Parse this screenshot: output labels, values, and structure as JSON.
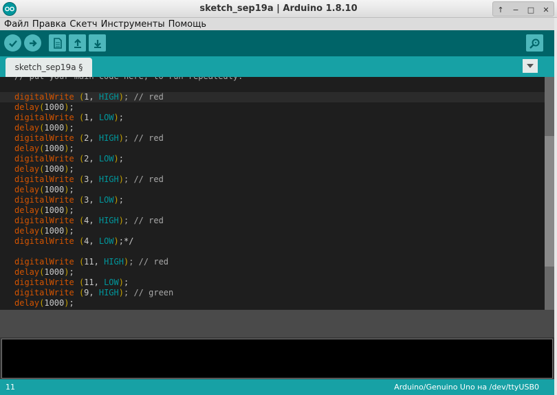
{
  "window": {
    "title": "sketch_sep19a | Arduino 1.8.10",
    "controls": [
      "↑",
      "−",
      "□",
      "✕"
    ]
  },
  "menu": {
    "items": [
      "Файл",
      "Правка",
      "Скетч",
      "Инструменты",
      "Помощь"
    ]
  },
  "toolbar": {
    "verify_icon": "check-icon",
    "upload_icon": "arrow-right-icon",
    "new_icon": "document-icon",
    "open_icon": "arrow-up-icon",
    "save_icon": "arrow-down-icon",
    "serial_monitor_icon": "magnifier-icon"
  },
  "tabs": {
    "active_label": "sketch_sep19a §"
  },
  "editor": {
    "lines": [
      [
        {
          "t": "// put your main code here, to run repeatedly:",
          "c": "comment"
        }
      ],
      [],
      [
        {
          "t": "digitalWrite",
          "c": "kw-fn"
        },
        {
          "t": " ",
          "c": "punc"
        },
        {
          "t": "(",
          "c": "paren"
        },
        {
          "t": "1, ",
          "c": "num"
        },
        {
          "t": "HIGH",
          "c": "kw-const"
        },
        {
          "t": ")",
          "c": "paren"
        },
        {
          "t": "; // red",
          "c": "comment"
        }
      ],
      [
        {
          "t": "delay",
          "c": "kw-fn"
        },
        {
          "t": "(",
          "c": "paren"
        },
        {
          "t": "1000",
          "c": "num"
        },
        {
          "t": ")",
          "c": "paren"
        },
        {
          "t": ";",
          "c": "punc"
        }
      ],
      [
        {
          "t": "digitalWrite",
          "c": "kw-fn"
        },
        {
          "t": " ",
          "c": "punc"
        },
        {
          "t": "(",
          "c": "paren"
        },
        {
          "t": "1, ",
          "c": "num"
        },
        {
          "t": "LOW",
          "c": "kw-const"
        },
        {
          "t": ")",
          "c": "paren"
        },
        {
          "t": ";",
          "c": "punc"
        }
      ],
      [
        {
          "t": "delay",
          "c": "kw-fn"
        },
        {
          "t": "(",
          "c": "paren"
        },
        {
          "t": "1000",
          "c": "num"
        },
        {
          "t": ")",
          "c": "paren"
        },
        {
          "t": ";",
          "c": "punc"
        }
      ],
      [
        {
          "t": "digitalWrite",
          "c": "kw-fn"
        },
        {
          "t": " ",
          "c": "punc"
        },
        {
          "t": "(",
          "c": "paren"
        },
        {
          "t": "2, ",
          "c": "num"
        },
        {
          "t": "HIGH",
          "c": "kw-const"
        },
        {
          "t": ")",
          "c": "paren"
        },
        {
          "t": "; // red",
          "c": "comment"
        }
      ],
      [
        {
          "t": "delay",
          "c": "kw-fn"
        },
        {
          "t": "(",
          "c": "paren"
        },
        {
          "t": "1000",
          "c": "num"
        },
        {
          "t": ")",
          "c": "paren"
        },
        {
          "t": ";",
          "c": "punc"
        }
      ],
      [
        {
          "t": "digitalWrite",
          "c": "kw-fn"
        },
        {
          "t": " ",
          "c": "punc"
        },
        {
          "t": "(",
          "c": "paren"
        },
        {
          "t": "2, ",
          "c": "num"
        },
        {
          "t": "LOW",
          "c": "kw-const"
        },
        {
          "t": ")",
          "c": "paren"
        },
        {
          "t": ";",
          "c": "punc"
        }
      ],
      [
        {
          "t": "delay",
          "c": "kw-fn"
        },
        {
          "t": "(",
          "c": "paren"
        },
        {
          "t": "1000",
          "c": "num"
        },
        {
          "t": ")",
          "c": "paren"
        },
        {
          "t": ";",
          "c": "punc"
        }
      ],
      [
        {
          "t": "digitalWrite",
          "c": "kw-fn"
        },
        {
          "t": " ",
          "c": "punc"
        },
        {
          "t": "(",
          "c": "paren"
        },
        {
          "t": "3, ",
          "c": "num"
        },
        {
          "t": "HIGH",
          "c": "kw-const"
        },
        {
          "t": ")",
          "c": "paren"
        },
        {
          "t": "; // red",
          "c": "comment"
        }
      ],
      [
        {
          "t": "delay",
          "c": "kw-fn"
        },
        {
          "t": "(",
          "c": "paren"
        },
        {
          "t": "1000",
          "c": "num"
        },
        {
          "t": ")",
          "c": "paren"
        },
        {
          "t": ";",
          "c": "punc"
        }
      ],
      [
        {
          "t": "digitalWrite",
          "c": "kw-fn"
        },
        {
          "t": " ",
          "c": "punc"
        },
        {
          "t": "(",
          "c": "paren"
        },
        {
          "t": "3, ",
          "c": "num"
        },
        {
          "t": "LOW",
          "c": "kw-const"
        },
        {
          "t": ")",
          "c": "paren"
        },
        {
          "t": ";",
          "c": "punc"
        }
      ],
      [
        {
          "t": "delay",
          "c": "kw-fn"
        },
        {
          "t": "(",
          "c": "paren"
        },
        {
          "t": "1000",
          "c": "num"
        },
        {
          "t": ")",
          "c": "paren"
        },
        {
          "t": ";",
          "c": "punc"
        }
      ],
      [
        {
          "t": "digitalWrite",
          "c": "kw-fn"
        },
        {
          "t": " ",
          "c": "punc"
        },
        {
          "t": "(",
          "c": "paren"
        },
        {
          "t": "4, ",
          "c": "num"
        },
        {
          "t": "HIGH",
          "c": "kw-const"
        },
        {
          "t": ")",
          "c": "paren"
        },
        {
          "t": "; // red",
          "c": "comment"
        }
      ],
      [
        {
          "t": "delay",
          "c": "kw-fn"
        },
        {
          "t": "(",
          "c": "paren"
        },
        {
          "t": "1000",
          "c": "num"
        },
        {
          "t": ")",
          "c": "paren"
        },
        {
          "t": ";",
          "c": "punc"
        }
      ],
      [
        {
          "t": "digitalWrite",
          "c": "kw-fn"
        },
        {
          "t": " ",
          "c": "punc"
        },
        {
          "t": "(",
          "c": "paren"
        },
        {
          "t": "4, ",
          "c": "num"
        },
        {
          "t": "LOW",
          "c": "kw-const"
        },
        {
          "t": ")",
          "c": "paren"
        },
        {
          "t": ";*/",
          "c": "punc"
        }
      ],
      [],
      [
        {
          "t": "digitalWrite",
          "c": "kw-fn"
        },
        {
          "t": " ",
          "c": "punc"
        },
        {
          "t": "(",
          "c": "paren"
        },
        {
          "t": "11, ",
          "c": "num"
        },
        {
          "t": "HIGH",
          "c": "kw-const"
        },
        {
          "t": ")",
          "c": "paren"
        },
        {
          "t": "; // red",
          "c": "comment"
        }
      ],
      [
        {
          "t": "delay",
          "c": "kw-fn"
        },
        {
          "t": "(",
          "c": "paren"
        },
        {
          "t": "1000",
          "c": "num"
        },
        {
          "t": ")",
          "c": "paren"
        },
        {
          "t": ";",
          "c": "punc"
        }
      ],
      [
        {
          "t": "digitalWrite",
          "c": "kw-fn"
        },
        {
          "t": " ",
          "c": "punc"
        },
        {
          "t": "(",
          "c": "paren"
        },
        {
          "t": "11, ",
          "c": "num"
        },
        {
          "t": "LOW",
          "c": "kw-const"
        },
        {
          "t": ")",
          "c": "paren"
        },
        {
          "t": ";",
          "c": "punc"
        }
      ],
      [
        {
          "t": "digitalWrite",
          "c": "kw-fn"
        },
        {
          "t": " ",
          "c": "punc"
        },
        {
          "t": "(",
          "c": "paren"
        },
        {
          "t": "9, ",
          "c": "num"
        },
        {
          "t": "HIGH",
          "c": "kw-const"
        },
        {
          "t": ")",
          "c": "paren"
        },
        {
          "t": "; // green",
          "c": "comment"
        }
      ],
      [
        {
          "t": "delay",
          "c": "kw-fn"
        },
        {
          "t": "(",
          "c": "paren"
        },
        {
          "t": "1000",
          "c": "num"
        },
        {
          "t": ")",
          "c": "paren"
        },
        {
          "t": ";",
          "c": "punc"
        }
      ]
    ],
    "current_line_index": 2
  },
  "status": {
    "line_number": "11",
    "board": "Arduino/Genuino Uno на /dev/ttyUSB0"
  },
  "colors": {
    "teal_dark": "#006468",
    "teal_light": "#17a1a5",
    "keyword": "#d35400",
    "constant": "#00979c"
  }
}
